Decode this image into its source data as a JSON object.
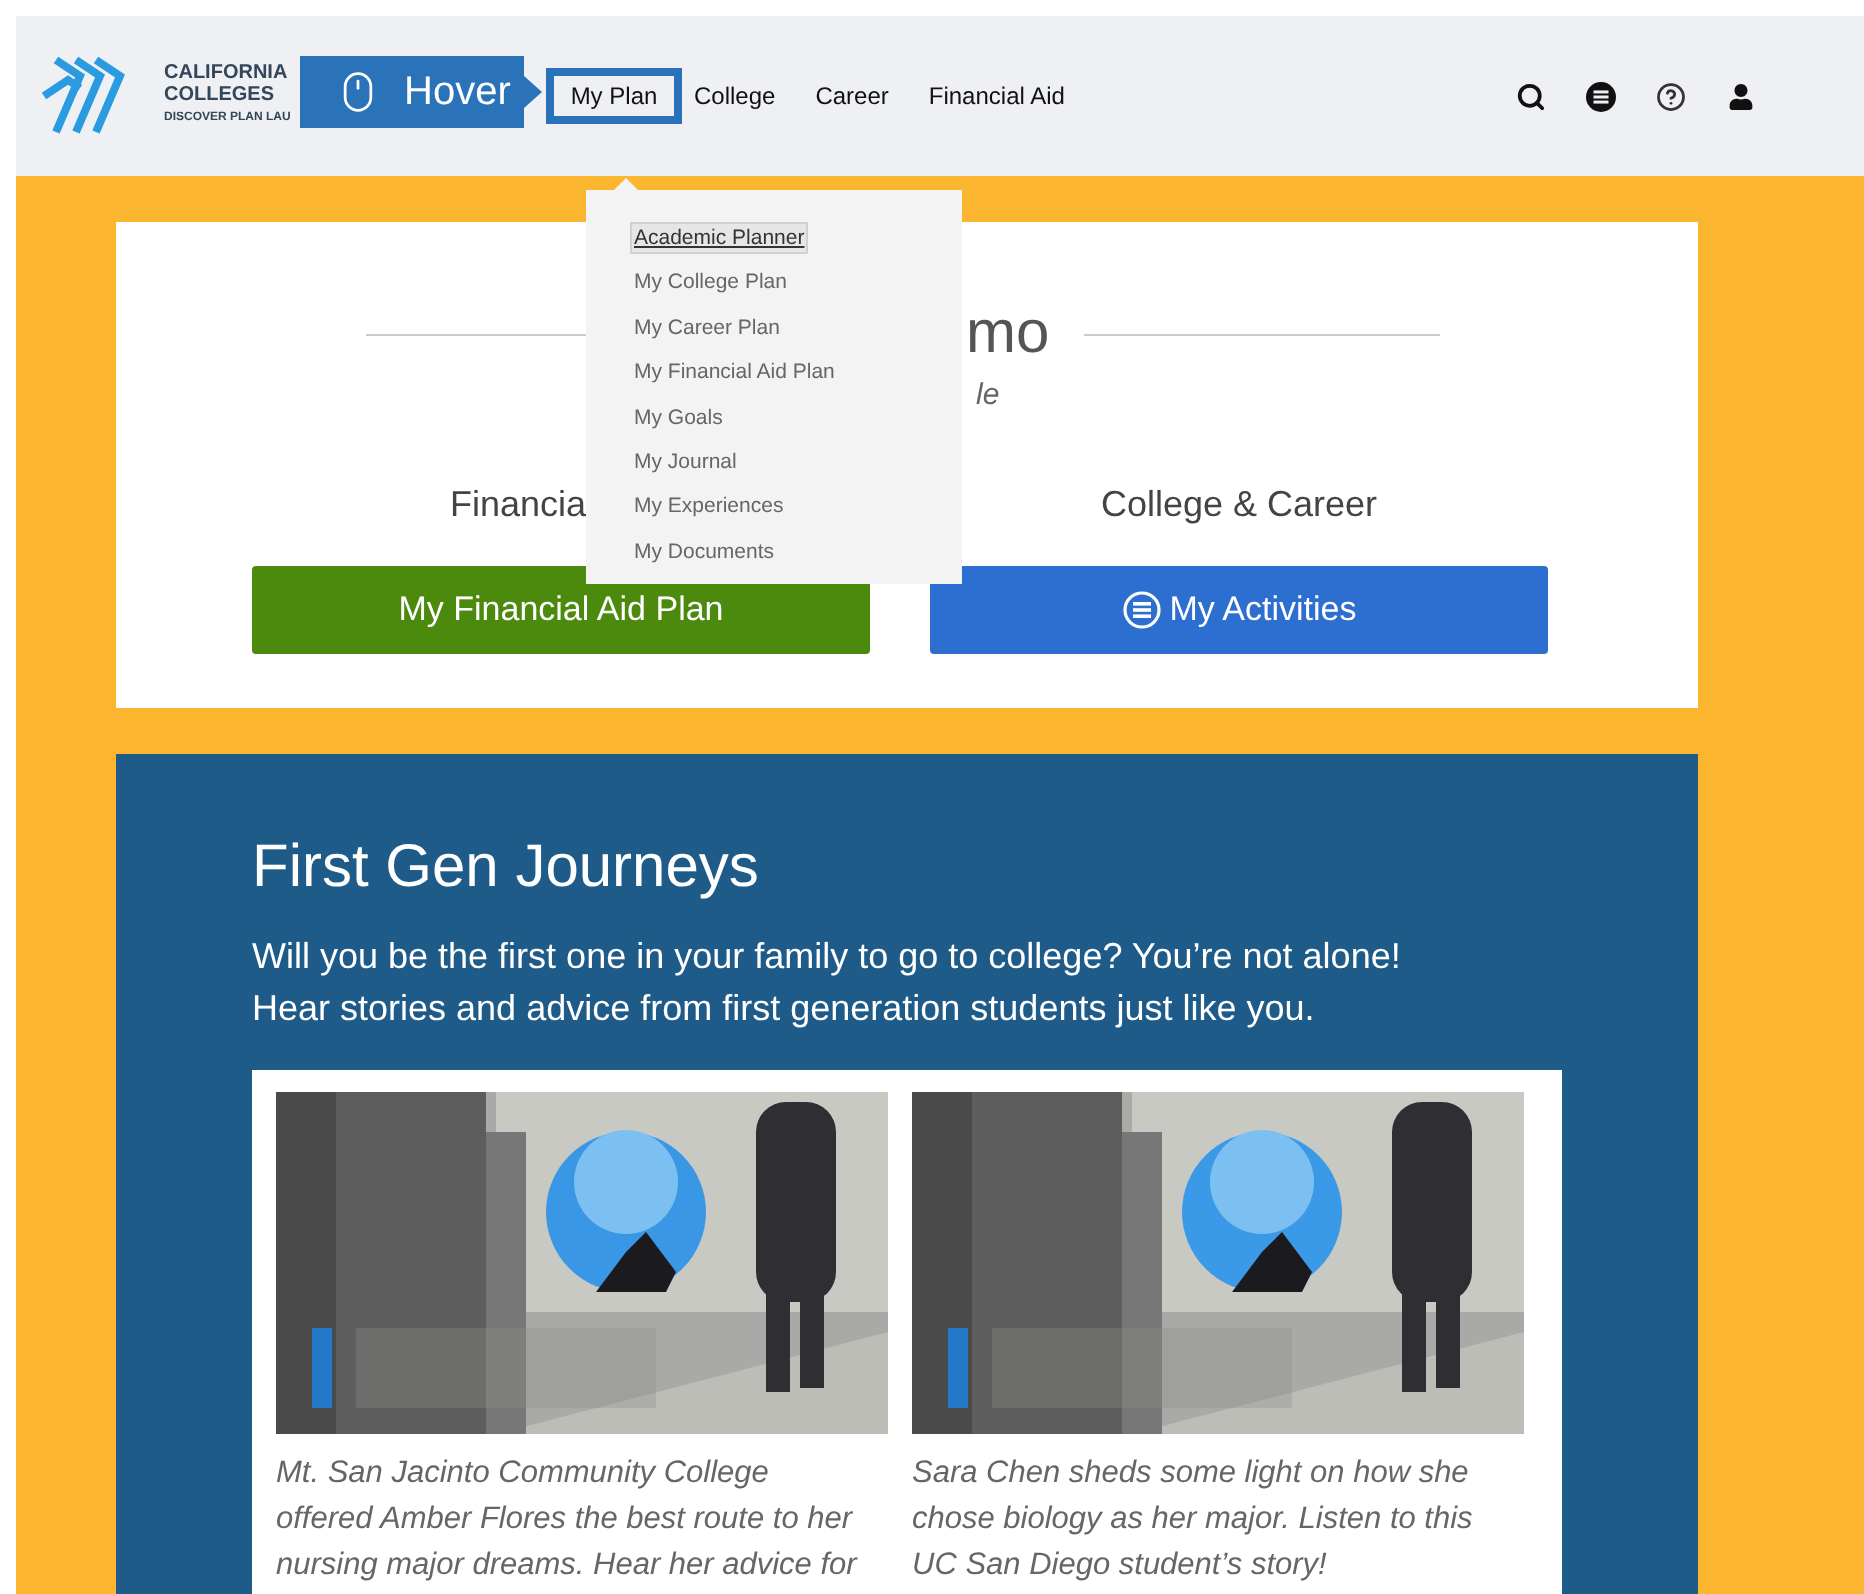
{
  "header": {
    "logo": {
      "lines": [
        "CALIFORNIA",
        "COLLEGES",
        "DISCOVER PLAN LAU"
      ]
    },
    "callout": {
      "label": "Hover"
    },
    "nav": [
      {
        "label": "My Plan",
        "selected": true
      },
      {
        "label": "College",
        "selected": false
      },
      {
        "label": "Career",
        "selected": false
      },
      {
        "label": "Financial Aid",
        "selected": false
      }
    ],
    "tools": [
      {
        "kind": "search"
      },
      {
        "kind": "list"
      },
      {
        "kind": "help"
      },
      {
        "kind": "user"
      }
    ]
  },
  "dropdown": {
    "items": [
      {
        "label": "Academic Planner",
        "selected": true
      },
      {
        "label": "My College Plan",
        "selected": false
      },
      {
        "label": "My Career Plan",
        "selected": false
      },
      {
        "label": "My Financial Aid Plan",
        "selected": false
      },
      {
        "label": "My Goals",
        "selected": false
      },
      {
        "label": "My Journal",
        "selected": false
      },
      {
        "label": "My Experiences",
        "selected": false
      },
      {
        "label": "My Documents",
        "selected": false
      }
    ]
  },
  "welcome": {
    "title": "mo",
    "subtitle": "le",
    "columns": [
      {
        "heading": "Financia",
        "button": "My Financial Aid Plan",
        "kind": "financial"
      },
      {
        "heading": "College & Career",
        "button": "My Activities",
        "kind": "activities"
      }
    ]
  },
  "journeys": {
    "title": "First Gen Journeys",
    "intro": "Will you be the first one in your family to go to college? You’re not alone! Hear stories and advice from first generation students just like you.",
    "videos": [
      {
        "kind": "picture",
        "description": "Mt. San Jacinto Community College offered Amber Flores the best route to her nursing major dreams. Hear her advice for"
      },
      {
        "kind": "picture",
        "description": "Sara Chen sheds some light on how she chose biology as her major. Listen to this UC San Diego student’s story!"
      }
    ]
  }
}
